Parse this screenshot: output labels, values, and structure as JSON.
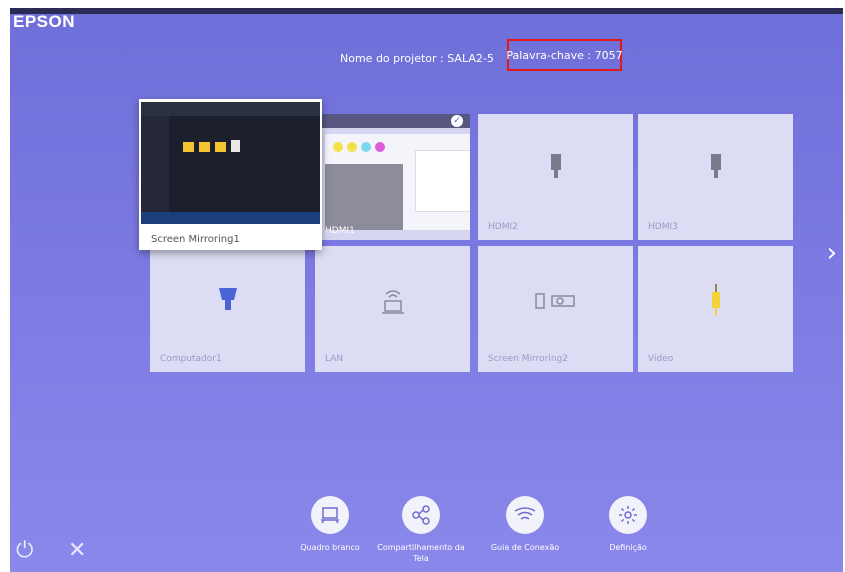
{
  "brand": "EPSON",
  "header": {
    "projector_name": "Nome do projetor : SALA2-5",
    "keyword": "Palavra-chave : 7057"
  },
  "sources": [
    {
      "id": "screen-mirroring1",
      "label": "Screen Mirroring1",
      "icon": "screen-preview",
      "selected_preview": true
    },
    {
      "id": "hdmi1",
      "label": "HDMI1",
      "icon": "content-preview",
      "active": true
    },
    {
      "id": "hdmi2",
      "label": "HDMI2",
      "icon": "hdmi-plug-icon"
    },
    {
      "id": "hdmi3",
      "label": "HDMI3",
      "icon": "hdmi-plug-icon"
    },
    {
      "id": "computador1",
      "label": "Computador1",
      "icon": "vga-plug-icon"
    },
    {
      "id": "lan",
      "label": "LAN",
      "icon": "network-computer-icon"
    },
    {
      "id": "screen-mirroring2",
      "label": "Screen Mirroring2",
      "icon": "screen-mirroring-icon"
    },
    {
      "id": "video",
      "label": "Video",
      "icon": "rca-plug-icon"
    }
  ],
  "bottom_menu": [
    {
      "label": "Quadro branco",
      "icon": "whiteboard-icon"
    },
    {
      "label": "Compartilhamento da Tela",
      "icon": "share-icon"
    },
    {
      "label": "Guia de Conexão",
      "icon": "wifi-icon"
    },
    {
      "label": "Definição",
      "icon": "gear-icon"
    }
  ],
  "colors": {
    "background": "#7c79e2",
    "tile": "#dcdcf4",
    "highlight_border": "#e01919",
    "video_plug": "#f3d23a"
  }
}
